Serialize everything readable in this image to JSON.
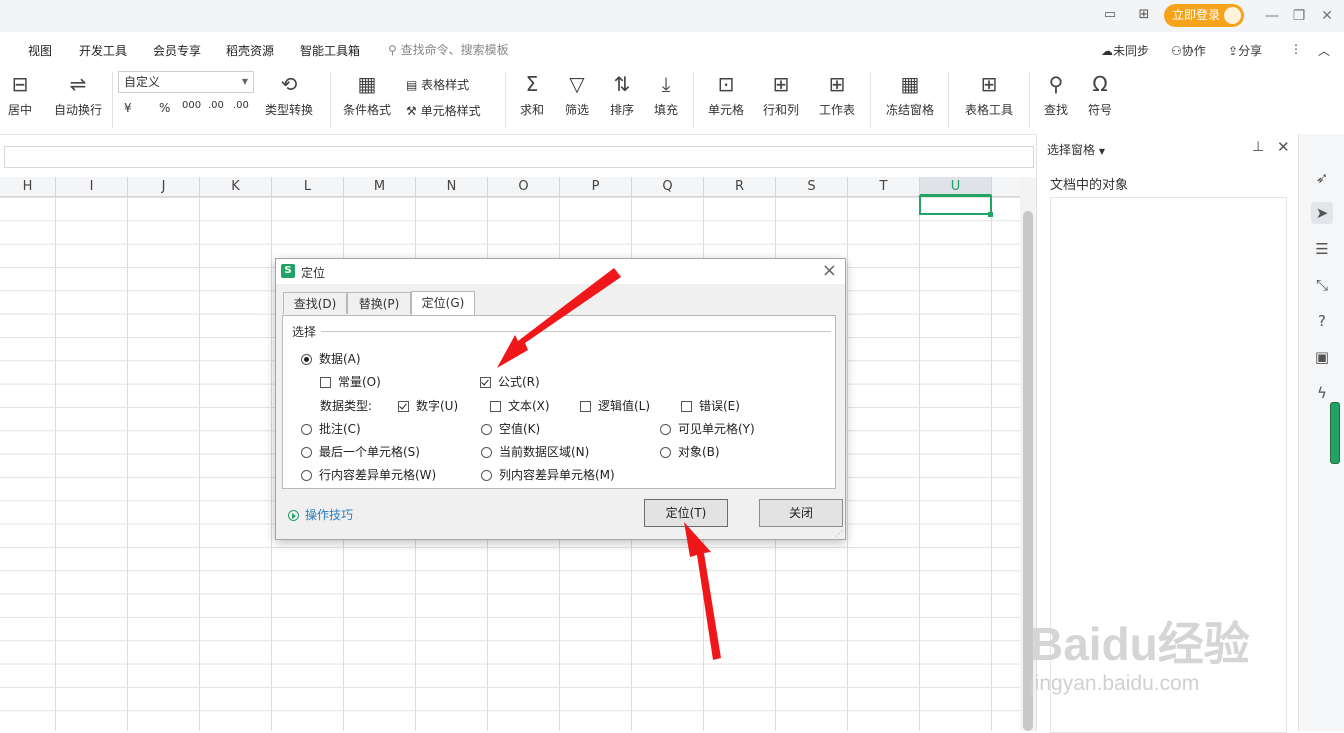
{
  "titlebar": {
    "login_label": "立即登录",
    "icons": [
      "page-layout-icon",
      "grid-apps-icon",
      "user-avatar-icon",
      "minimize-icon",
      "restore-icon",
      "close-icon"
    ]
  },
  "menu": {
    "items": [
      "视图",
      "开发工具",
      "会员专享",
      "稻壳资源",
      "智能工具箱"
    ],
    "search_placeholder": "查找命令、搜索模板",
    "right": {
      "sync": "未同步",
      "collab": "协作",
      "share": "分享"
    }
  },
  "ribbon": {
    "merge_center": "居中",
    "wrap": "自动换行",
    "number_format": "自定义",
    "currency": "¥",
    "percent": "%",
    "thousands": "000",
    "dec_inc": ".00",
    "dec_dec": ".00",
    "type_convert": "类型转换",
    "cond_format": "条件格式",
    "table_style": "表格样式",
    "cell_style": "单元格样式",
    "sum": "求和",
    "filter": "筛选",
    "sort": "排序",
    "fill": "填充",
    "cell": "单元格",
    "row_col": "行和列",
    "sheet": "工作表",
    "freeze": "冻结窗格",
    "table_tools": "表格工具",
    "find": "查找",
    "symbol": "符号"
  },
  "sheet": {
    "columns": [
      "H",
      "I",
      "J",
      "K",
      "L",
      "M",
      "N",
      "O",
      "P",
      "Q",
      "R",
      "S",
      "T",
      "U"
    ],
    "selected_column": "U"
  },
  "pane": {
    "title": "选择窗格",
    "subtitle": "文档中的对象"
  },
  "dialog": {
    "title": "定位",
    "tabs": [
      "查找(D)",
      "替换(P)",
      "定位(G)"
    ],
    "active_tab": "定位(G)",
    "group_label": "选择",
    "data_radio": "数据(A)",
    "constant": "常量(O)",
    "formula": "公式(R)",
    "data_type_label": "数据类型:",
    "types": {
      "number": "数字(U)",
      "text": "文本(X)",
      "logical": "逻辑值(L)",
      "error": "错误(E)"
    },
    "radios": {
      "comment": "批注(C)",
      "blank": "空值(K)",
      "visible": "可见单元格(Y)",
      "last_cell": "最后一个单元格(S)",
      "current_region": "当前数据区域(N)",
      "object": "对象(B)",
      "row_diff": "行内容差异单元格(W)",
      "col_diff": "列内容差异单元格(M)"
    },
    "tips": "操作技巧",
    "locate_button": "定位(T)",
    "close_button": "关闭"
  },
  "watermark": {
    "brand": "Baidu经验",
    "url": "jingyan.baidu.com"
  },
  "colors": {
    "accent": "#21a366",
    "login": "#f7a21b",
    "arrow": "#f0171a"
  }
}
